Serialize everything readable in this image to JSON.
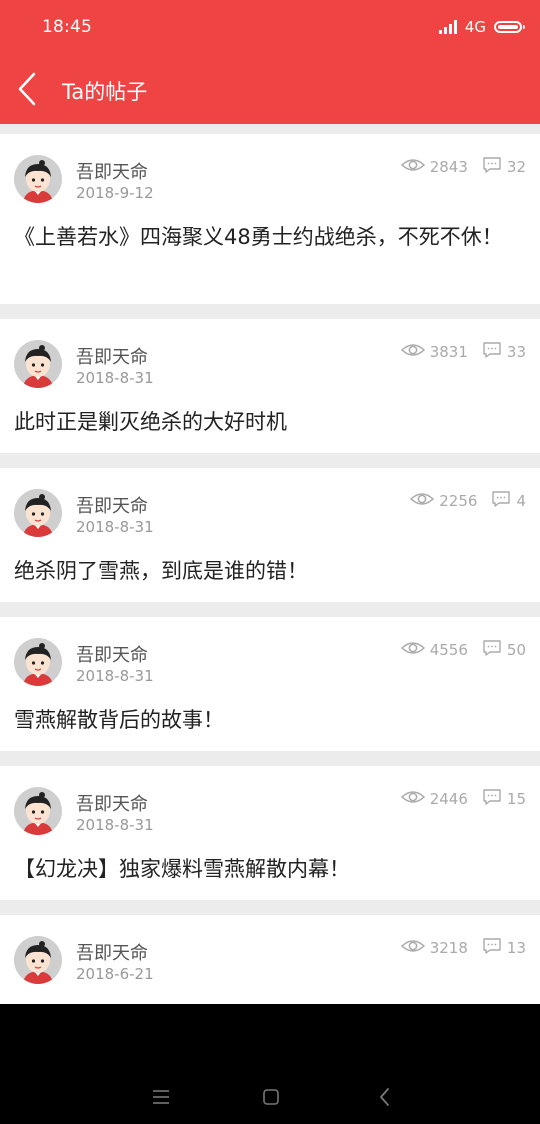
{
  "status": {
    "time": "18:45",
    "network": "4G"
  },
  "appbar": {
    "title": "Ta的帖子"
  },
  "posts": [
    {
      "author": "吾即天命",
      "date": "2018-9-12",
      "views": "2843",
      "comments": "32",
      "title": "《上善若水》四海聚义48勇士约战绝杀，不死不休！"
    },
    {
      "author": "吾即天命",
      "date": "2018-8-31",
      "views": "3831",
      "comments": "33",
      "title": "此时正是剿灭绝杀的大好时机"
    },
    {
      "author": "吾即天命",
      "date": "2018-8-31",
      "views": "2256",
      "comments": "4",
      "title": "绝杀阴了雪燕，到底是谁的错！"
    },
    {
      "author": "吾即天命",
      "date": "2018-8-31",
      "views": "4556",
      "comments": "50",
      "title": "雪燕解散背后的故事！"
    },
    {
      "author": "吾即天命",
      "date": "2018-8-31",
      "views": "2446",
      "comments": "15",
      "title": "【幻龙决】独家爆料雪燕解散内幕！"
    },
    {
      "author": "吾即天命",
      "date": "2018-6-21",
      "views": "3218",
      "comments": "13",
      "title": ""
    }
  ],
  "icons": {
    "back": "back-arrow-icon",
    "views": "eye-icon",
    "comments": "comment-icon",
    "nav_menu": "menu-icon",
    "nav_home": "home-square-icon",
    "nav_back": "back-chevron-icon"
  },
  "colors": {
    "primary": "#ee4444",
    "background": "#ececec",
    "card": "#ffffff",
    "text": "#222222",
    "secondary_text": "#999999"
  }
}
